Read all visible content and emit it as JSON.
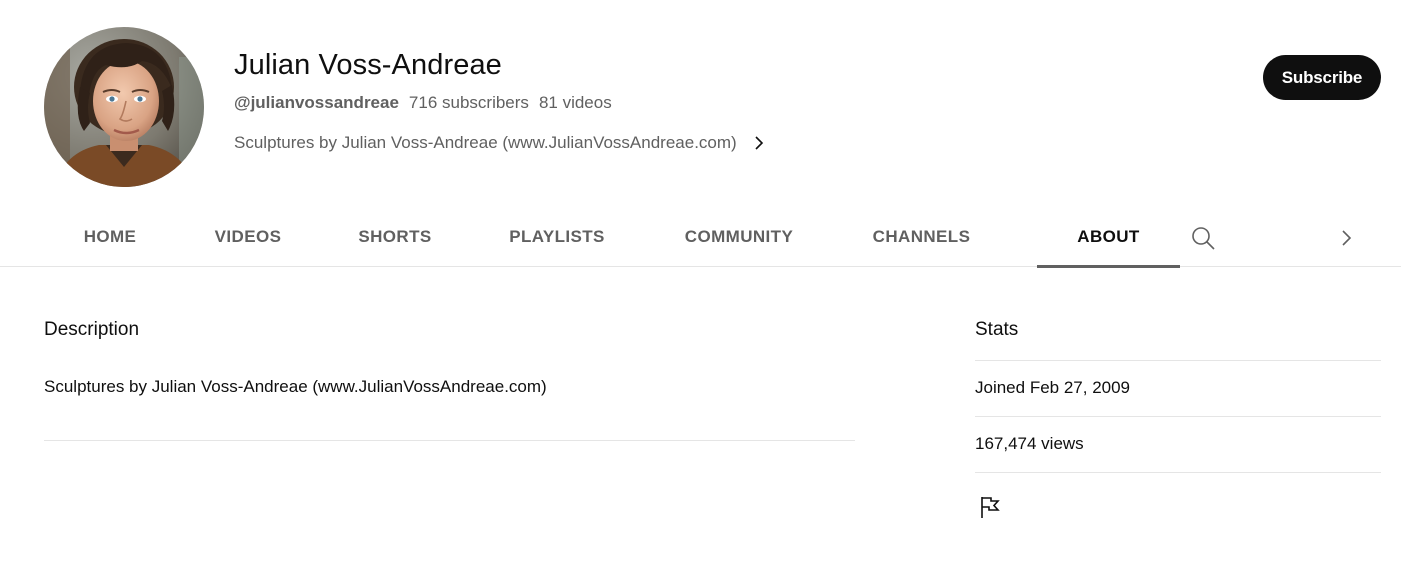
{
  "channel": {
    "name": "Julian Voss-Andreae",
    "handle": "@julianvossandreae",
    "subscribers": "716 subscribers",
    "videos": "81 videos",
    "tagline": "Sculptures by Julian Voss-Andreae (www.JulianVossAndreae.com)"
  },
  "subscribe_label": "Subscribe",
  "tabs": [
    {
      "label": "HOME"
    },
    {
      "label": "VIDEOS"
    },
    {
      "label": "SHORTS"
    },
    {
      "label": "PLAYLISTS"
    },
    {
      "label": "COMMUNITY"
    },
    {
      "label": "CHANNELS"
    },
    {
      "label": "ABOUT",
      "active": true
    }
  ],
  "icons": {
    "tagline_more": "chevron-right-icon",
    "tab_search": "search-icon",
    "tab_scroll": "chevron-right-icon",
    "report": "flag-icon"
  },
  "about": {
    "description_heading": "Description",
    "description_text": "Sculptures by Julian Voss-Andreae (www.JulianVossAndreae.com)",
    "stats_heading": "Stats",
    "joined": "Joined Feb 27, 2009",
    "views": "167,474 views"
  },
  "colors": {
    "subscribe_bg": "#0f0f0f",
    "secondary_text": "#606060",
    "divider": "#e5e5e5"
  }
}
